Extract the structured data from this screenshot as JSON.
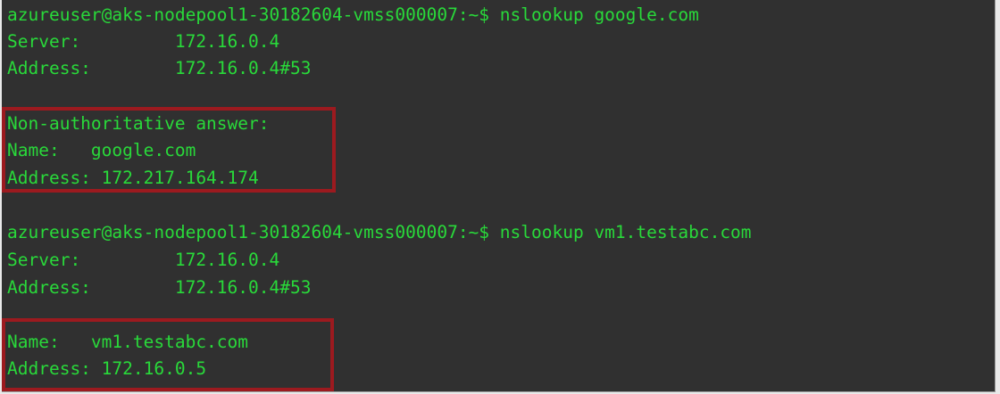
{
  "terminal": {
    "lines": [
      "azureuser@aks-nodepool1-30182604-vmss000007:~$ nslookup google.com",
      "Server:         172.16.0.4",
      "Address:        172.16.0.4#53",
      "",
      "Non-authoritative answer:",
      "Name:   google.com",
      "Address: 172.217.164.174",
      "",
      "azureuser@aks-nodepool1-30182604-vmss000007:~$ nslookup vm1.testabc.com",
      "Server:         172.16.0.4",
      "Address:        172.16.0.4#53",
      "",
      "Name:   vm1.testabc.com",
      "Address: 172.16.0.5"
    ]
  },
  "colors": {
    "background": "#303030",
    "text": "#29d93a",
    "highlight_border": "#9c1a1f"
  }
}
